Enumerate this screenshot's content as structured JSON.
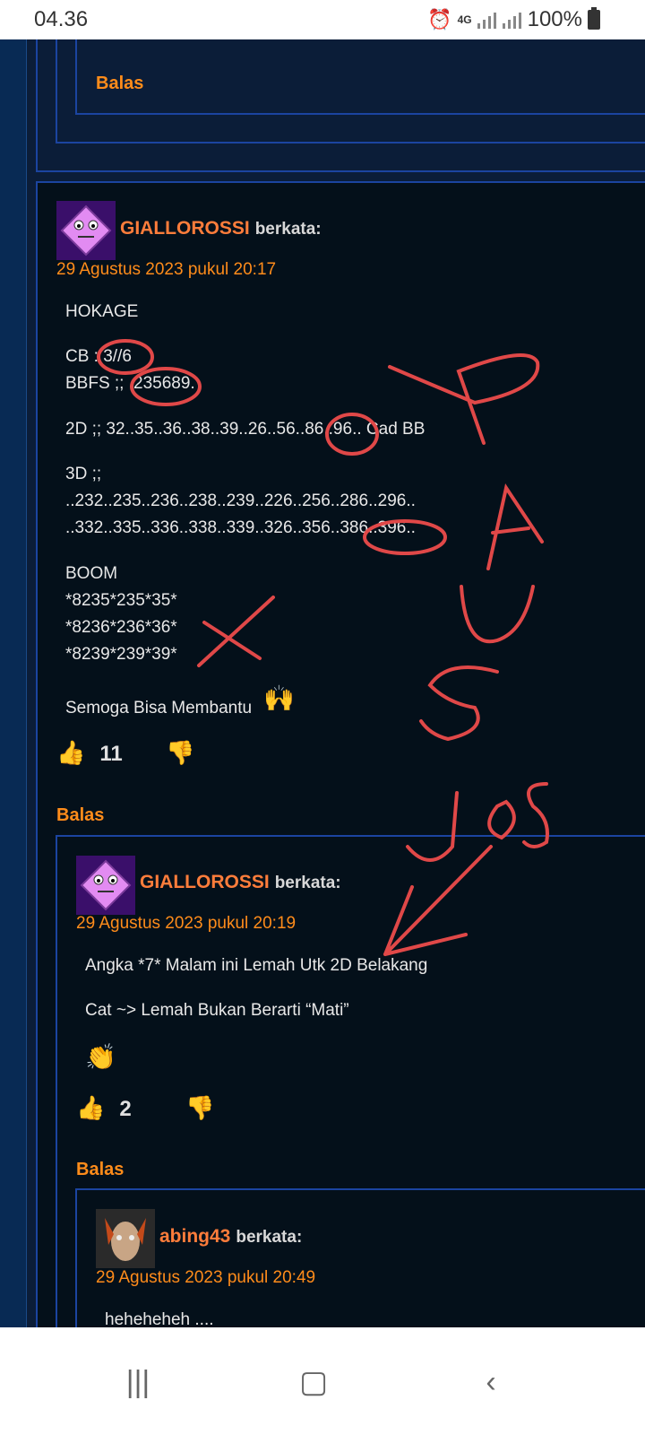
{
  "status": {
    "time": "04.36",
    "network": "4G",
    "battery": "100%"
  },
  "top_reply": {
    "balas": "Balas"
  },
  "comment1": {
    "author": "GIALLOROSSI",
    "berkata": "berkata:",
    "date": "29 Agustus 2023 pukul 20:17",
    "lines": [
      "HOKAGE",
      "CB : 3//6",
      "BBFS ;; .235689.",
      "2D ;; 32..35..36..38..39..26..56..86..96.. Cad BB",
      "3D ;;",
      "..232..235..236..238..239..226..256..286..296..",
      "..332..335..336..338..339..326..356..386..396..",
      "BOOM",
      "*8235*235*35*",
      "*8236*236*36*",
      "*8239*239*39*",
      "Semoga Bisa Membantu"
    ],
    "likes": "11",
    "balas": "Balas"
  },
  "comment2": {
    "author": "GIALLOROSSI",
    "berkata": "berkata:",
    "date": "29 Agustus 2023 pukul 20:19",
    "lines": [
      "Angka *7* Malam ini Lemah Utk 2D Belakang",
      "Cat ~> Lemah Bukan Berarti “Mati”"
    ],
    "likes": "2",
    "balas": "Balas"
  },
  "comment3": {
    "author": "abing43",
    "berkata": "berkata:",
    "date": "29 Agustus 2023 pukul 20:49",
    "lines": [
      "heheheheh ...."
    ]
  },
  "icons": {
    "like": "thumbs-up-icon",
    "dislike": "thumbs-down-icon",
    "alarm": "alarm-icon"
  },
  "colors": {
    "accent": "#ff8c1a",
    "author": "#ff7d3b",
    "annotation": "#e04848",
    "thumb": "#2a8cf0"
  }
}
